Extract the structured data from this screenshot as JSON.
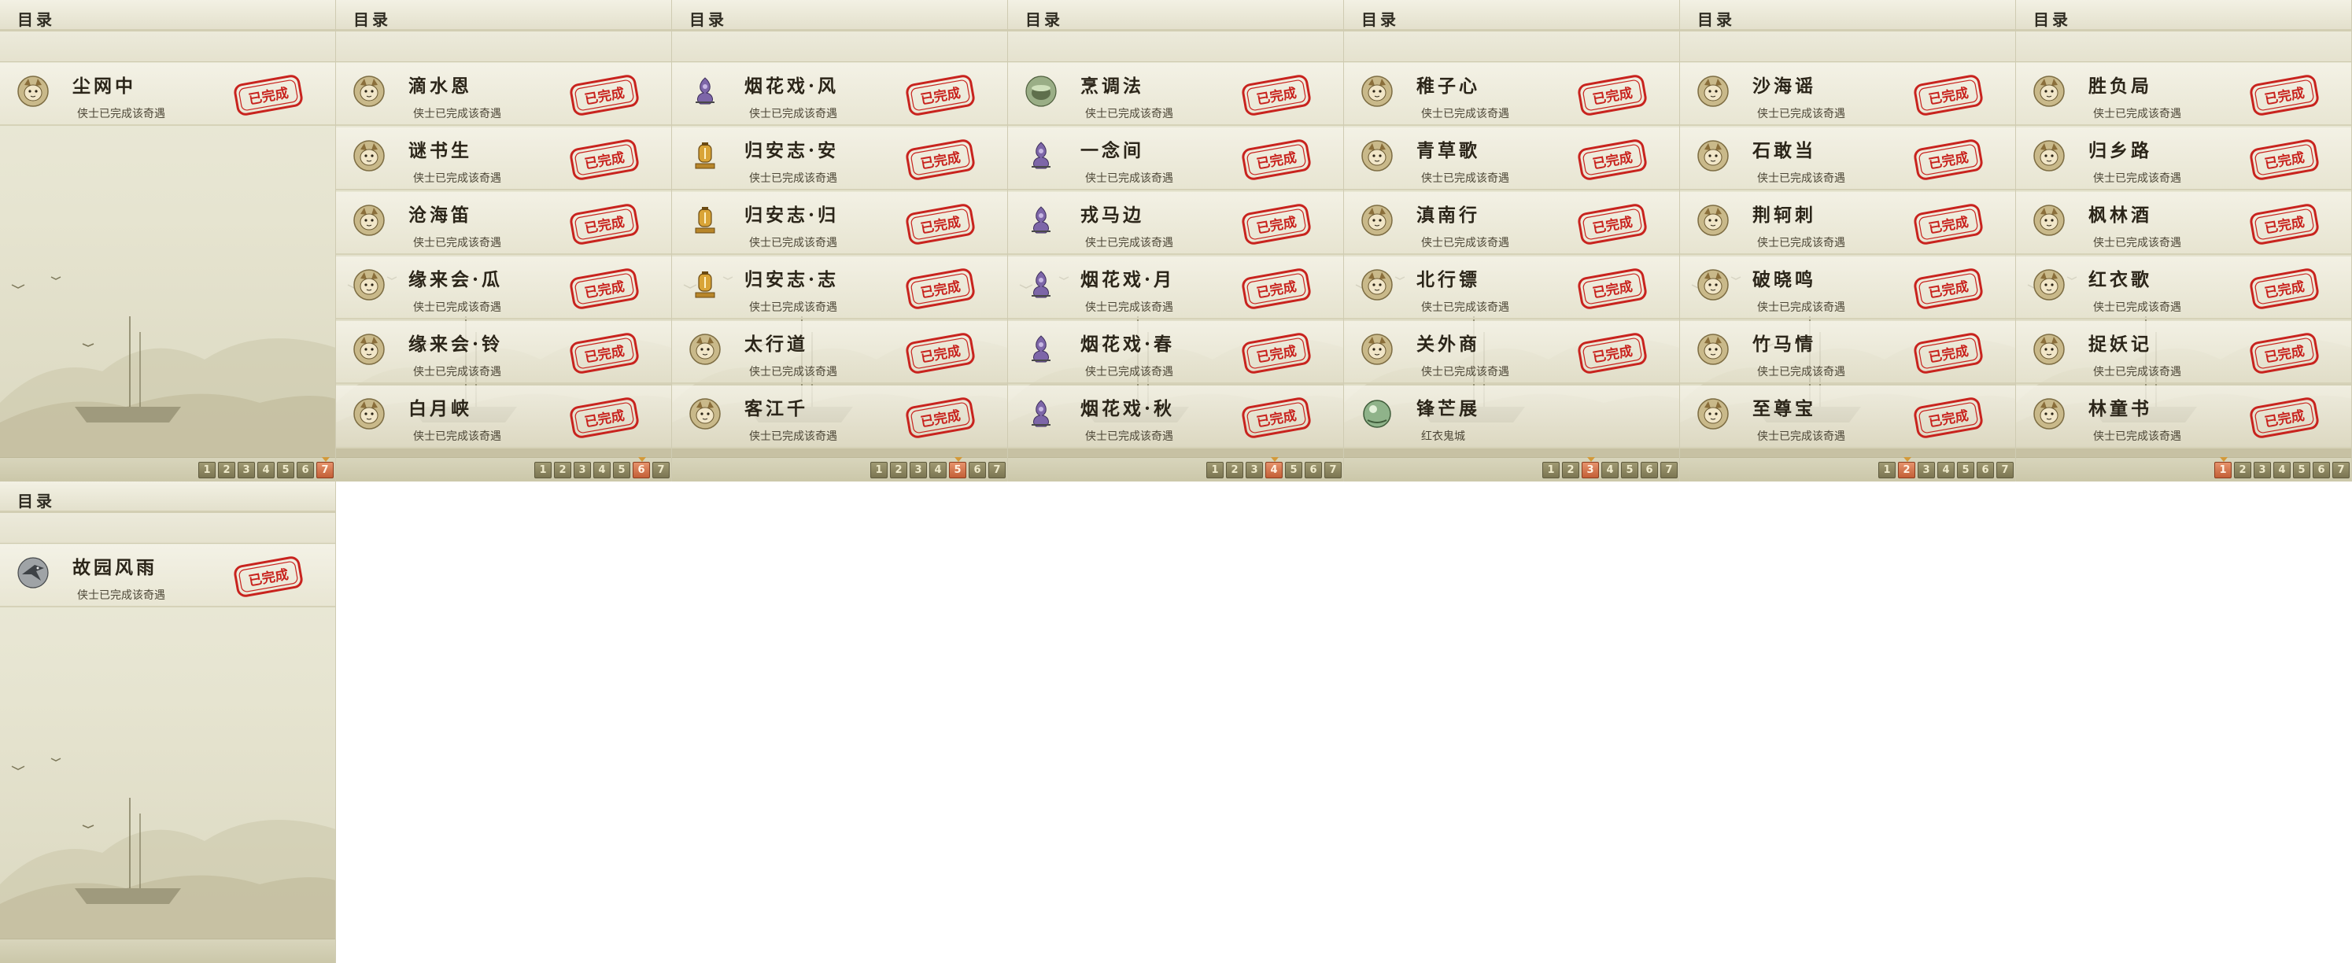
{
  "colors": {
    "stamp_red": "#c8231e",
    "active_page": "#c96a3f",
    "page_button": "#8a8460"
  },
  "panels": [
    {
      "title": "目录",
      "active_page": 7,
      "entries": [
        {
          "title": "尘网中",
          "subtitle": "侠士已完成该奇遇",
          "icon": "cat-icon",
          "stamp": "已完成"
        }
      ]
    },
    {
      "title": "目录",
      "active_page": 6,
      "entries": [
        {
          "title": "滴水恩",
          "subtitle": "侠士已完成该奇遇",
          "icon": "cat-icon",
          "stamp": "已完成"
        },
        {
          "title": "谜书生",
          "subtitle": "侠士已完成该奇遇",
          "icon": "cat-icon",
          "stamp": "已完成"
        },
        {
          "title": "沧海笛",
          "subtitle": "侠士已完成该奇遇",
          "icon": "cat-icon",
          "stamp": "已完成"
        },
        {
          "title": "缘来会·瓜",
          "subtitle": "侠士已完成该奇遇",
          "icon": "cat-icon",
          "stamp": "已完成"
        },
        {
          "title": "缘来会·铃",
          "subtitle": "侠士已完成该奇遇",
          "icon": "cat-icon",
          "stamp": "已完成"
        },
        {
          "title": "白月峡",
          "subtitle": "侠士已完成该奇遇",
          "icon": "cat-icon",
          "stamp": "已完成"
        }
      ]
    },
    {
      "title": "目录",
      "active_page": 5,
      "entries": [
        {
          "title": "烟花戏·风",
          "subtitle": "侠士已完成该奇遇",
          "icon": "firework-icon",
          "stamp": "已完成"
        },
        {
          "title": "归安志·安",
          "subtitle": "侠士已完成该奇遇",
          "icon": "lantern-icon",
          "stamp": "已完成"
        },
        {
          "title": "归安志·归",
          "subtitle": "侠士已完成该奇遇",
          "icon": "lantern-icon",
          "stamp": "已完成"
        },
        {
          "title": "归安志·志",
          "subtitle": "侠士已完成该奇遇",
          "icon": "lantern-icon",
          "stamp": "已完成"
        },
        {
          "title": "太行道",
          "subtitle": "侠士已完成该奇遇",
          "icon": "cat-icon",
          "stamp": "已完成"
        },
        {
          "title": "客江千",
          "subtitle": "侠士已完成该奇遇",
          "icon": "cat-icon",
          "stamp": "已完成"
        }
      ]
    },
    {
      "title": "目录",
      "active_page": 4,
      "entries": [
        {
          "title": "烹调法",
          "subtitle": "侠士已完成该奇遇",
          "icon": "cauldron-icon",
          "stamp": "已完成"
        },
        {
          "title": "一念间",
          "subtitle": "侠士已完成该奇遇",
          "icon": "firework-icon",
          "stamp": "已完成"
        },
        {
          "title": "戎马边",
          "subtitle": "侠士已完成该奇遇",
          "icon": "firework-icon",
          "stamp": "已完成"
        },
        {
          "title": "烟花戏·月",
          "subtitle": "侠士已完成该奇遇",
          "icon": "firework-icon",
          "stamp": "已完成"
        },
        {
          "title": "烟花戏·春",
          "subtitle": "侠士已完成该奇遇",
          "icon": "firework-icon",
          "stamp": "已完成"
        },
        {
          "title": "烟花戏·秋",
          "subtitle": "侠士已完成该奇遇",
          "icon": "firework-icon",
          "stamp": "已完成"
        }
      ]
    },
    {
      "title": "目录",
      "active_page": 3,
      "entries": [
        {
          "title": "稚子心",
          "subtitle": "侠士已完成该奇遇",
          "icon": "cat-icon",
          "stamp": "已完成"
        },
        {
          "title": "青草歌",
          "subtitle": "侠士已完成该奇遇",
          "icon": "cat-icon",
          "stamp": "已完成"
        },
        {
          "title": "滇南行",
          "subtitle": "侠士已完成该奇遇",
          "icon": "cat-icon",
          "stamp": "已完成"
        },
        {
          "title": "北行镖",
          "subtitle": "侠士已完成该奇遇",
          "icon": "cat-icon",
          "stamp": "已完成"
        },
        {
          "title": "关外商",
          "subtitle": "侠士已完成该奇遇",
          "icon": "cat-icon",
          "stamp": "已完成"
        },
        {
          "title": "锋芒展",
          "subtitle": "红衣鬼城",
          "icon": "orb-icon",
          "stamp": ""
        }
      ]
    },
    {
      "title": "目录",
      "active_page": 2,
      "entries": [
        {
          "title": "沙海谣",
          "subtitle": "侠士已完成该奇遇",
          "icon": "cat-icon",
          "stamp": "已完成"
        },
        {
          "title": "石敢当",
          "subtitle": "侠士已完成该奇遇",
          "icon": "cat-icon",
          "stamp": "已完成"
        },
        {
          "title": "荆轲刺",
          "subtitle": "侠士已完成该奇遇",
          "icon": "cat-icon",
          "stamp": "已完成"
        },
        {
          "title": "破晓鸣",
          "subtitle": "侠士已完成该奇遇",
          "icon": "cat-icon",
          "stamp": "已完成"
        },
        {
          "title": "竹马情",
          "subtitle": "侠士已完成该奇遇",
          "icon": "cat-icon",
          "stamp": "已完成"
        },
        {
          "title": "至尊宝",
          "subtitle": "侠士已完成该奇遇",
          "icon": "cat-icon",
          "stamp": "已完成"
        }
      ]
    },
    {
      "title": "目录",
      "active_page": 1,
      "entries": [
        {
          "title": "胜负局",
          "subtitle": "侠士已完成该奇遇",
          "icon": "cat-icon",
          "stamp": "已完成"
        },
        {
          "title": "归乡路",
          "subtitle": "侠士已完成该奇遇",
          "icon": "cat-icon",
          "stamp": "已完成"
        },
        {
          "title": "枫林酒",
          "subtitle": "侠士已完成该奇遇",
          "icon": "cat-icon",
          "stamp": "已完成"
        },
        {
          "title": "红衣歌",
          "subtitle": "侠士已完成该奇遇",
          "icon": "cat-icon",
          "stamp": "已完成"
        },
        {
          "title": "捉妖记",
          "subtitle": "侠士已完成该奇遇",
          "icon": "cat-icon",
          "stamp": "已完成"
        },
        {
          "title": "林童书",
          "subtitle": "侠士已完成该奇遇",
          "icon": "cat-icon",
          "stamp": "已完成"
        }
      ]
    },
    {
      "title": "目录",
      "active_page": null,
      "entries": [
        {
          "title": "故园风雨",
          "subtitle": "侠士已完成该奇遇",
          "icon": "bird-icon",
          "stamp": "已完成"
        }
      ]
    }
  ],
  "pagination": [
    "1",
    "2",
    "3",
    "4",
    "5",
    "6",
    "7"
  ]
}
